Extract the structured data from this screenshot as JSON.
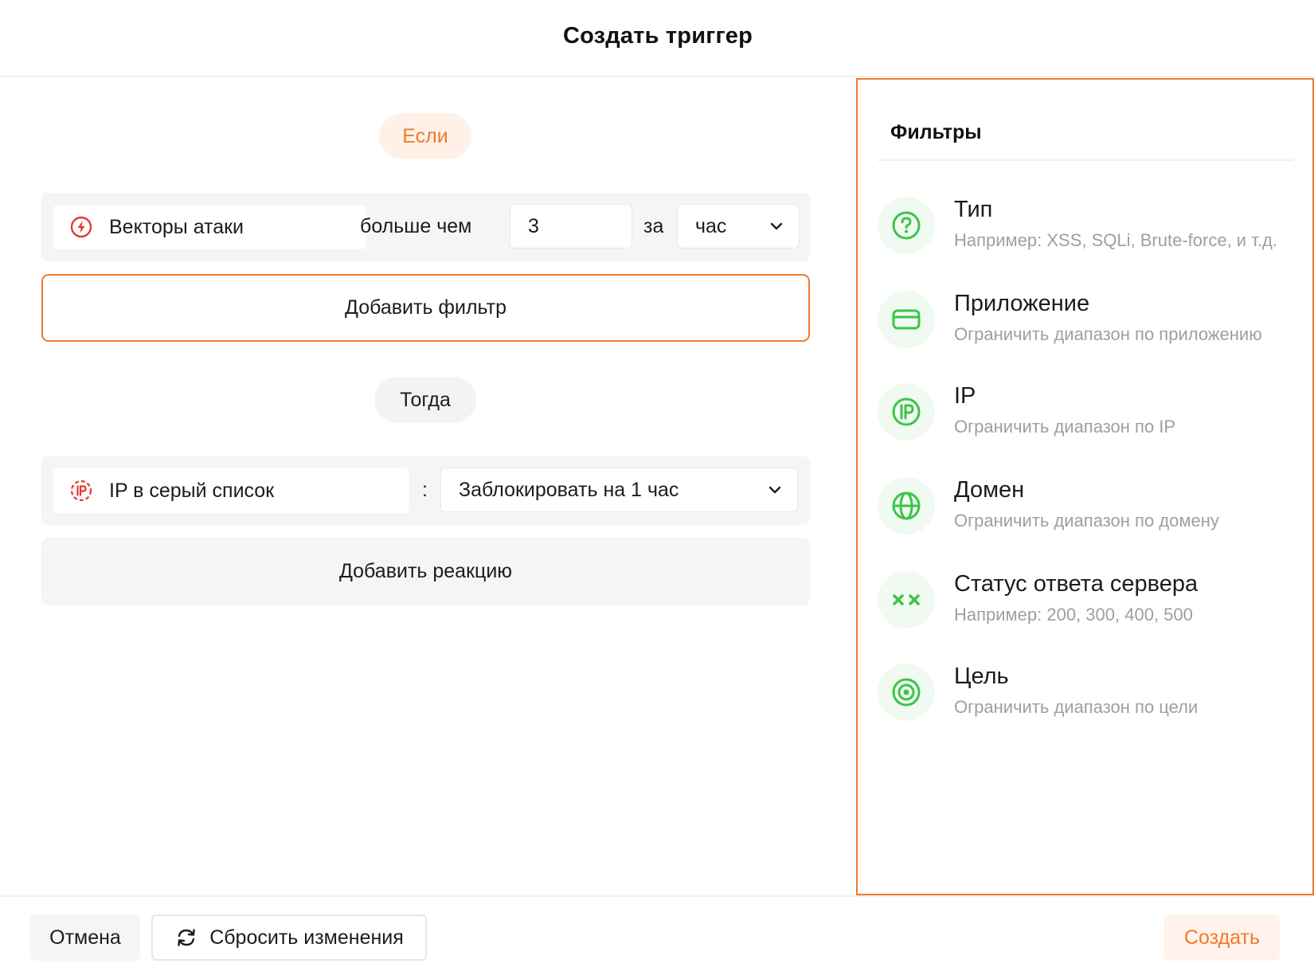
{
  "header": {
    "title": "Создать триггер"
  },
  "editor": {
    "if_label": "Если",
    "condition": {
      "vector_label": "Векторы атаки",
      "comparator": "больше чем",
      "count_value": "3",
      "per_label": "за",
      "period_value": "час"
    },
    "add_filter_label": "Добавить фильтр",
    "then_label": "Тогда",
    "action": {
      "ip_label": "IP в серый список",
      "separator": ":",
      "block_value": "Заблокировать на 1 час"
    },
    "add_reaction_label": "Добавить реакцию"
  },
  "filters": {
    "title": "Фильтры",
    "items": [
      {
        "icon": "question-icon",
        "name": "Тип",
        "description": "Например: XSS, SQLi, Brute-force, и т.д."
      },
      {
        "icon": "card-icon",
        "name": "Приложение",
        "description": "Ограничить диапазон по приложению"
      },
      {
        "icon": "ip-icon",
        "name": "IP",
        "description": "Ограничить диапазон по IP"
      },
      {
        "icon": "globe-icon",
        "name": "Домен",
        "description": "Ограничить диапазон по домену"
      },
      {
        "icon": "xx-icon",
        "name": "Статус ответа сервера",
        "description": "Например: 200, 300, 400, 500"
      },
      {
        "icon": "target-icon",
        "name": "Цель",
        "description": "Ограничить диапазон по цели"
      }
    ]
  },
  "footer": {
    "cancel_label": "Отмена",
    "reset_label": "Сбросить изменения",
    "create_label": "Создать"
  },
  "colors": {
    "accent": "#f07a2c",
    "filter_icon": "#3cc44a",
    "attack_icon": "#e53935"
  }
}
